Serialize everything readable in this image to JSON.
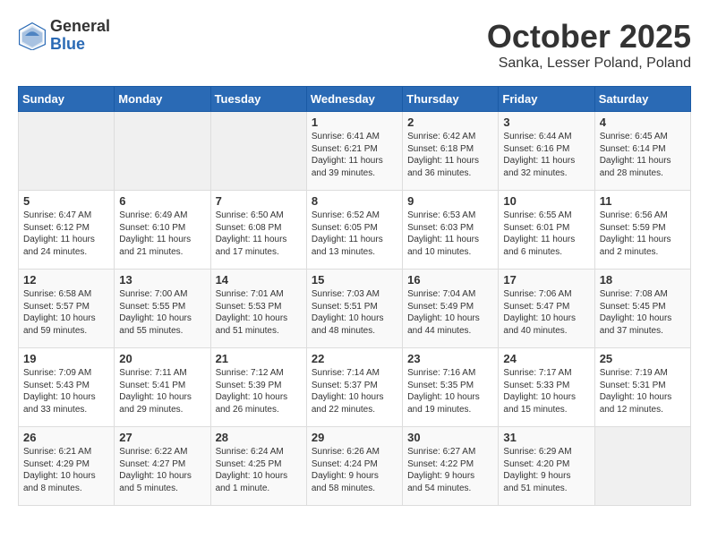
{
  "header": {
    "logo_general": "General",
    "logo_blue": "Blue",
    "month_title": "October 2025",
    "location": "Sanka, Lesser Poland, Poland"
  },
  "weekdays": [
    "Sunday",
    "Monday",
    "Tuesday",
    "Wednesday",
    "Thursday",
    "Friday",
    "Saturday"
  ],
  "weeks": [
    [
      {
        "day": "",
        "info": ""
      },
      {
        "day": "",
        "info": ""
      },
      {
        "day": "",
        "info": ""
      },
      {
        "day": "1",
        "info": "Sunrise: 6:41 AM\nSunset: 6:21 PM\nDaylight: 11 hours\nand 39 minutes."
      },
      {
        "day": "2",
        "info": "Sunrise: 6:42 AM\nSunset: 6:18 PM\nDaylight: 11 hours\nand 36 minutes."
      },
      {
        "day": "3",
        "info": "Sunrise: 6:44 AM\nSunset: 6:16 PM\nDaylight: 11 hours\nand 32 minutes."
      },
      {
        "day": "4",
        "info": "Sunrise: 6:45 AM\nSunset: 6:14 PM\nDaylight: 11 hours\nand 28 minutes."
      }
    ],
    [
      {
        "day": "5",
        "info": "Sunrise: 6:47 AM\nSunset: 6:12 PM\nDaylight: 11 hours\nand 24 minutes."
      },
      {
        "day": "6",
        "info": "Sunrise: 6:49 AM\nSunset: 6:10 PM\nDaylight: 11 hours\nand 21 minutes."
      },
      {
        "day": "7",
        "info": "Sunrise: 6:50 AM\nSunset: 6:08 PM\nDaylight: 11 hours\nand 17 minutes."
      },
      {
        "day": "8",
        "info": "Sunrise: 6:52 AM\nSunset: 6:05 PM\nDaylight: 11 hours\nand 13 minutes."
      },
      {
        "day": "9",
        "info": "Sunrise: 6:53 AM\nSunset: 6:03 PM\nDaylight: 11 hours\nand 10 minutes."
      },
      {
        "day": "10",
        "info": "Sunrise: 6:55 AM\nSunset: 6:01 PM\nDaylight: 11 hours\nand 6 minutes."
      },
      {
        "day": "11",
        "info": "Sunrise: 6:56 AM\nSunset: 5:59 PM\nDaylight: 11 hours\nand 2 minutes."
      }
    ],
    [
      {
        "day": "12",
        "info": "Sunrise: 6:58 AM\nSunset: 5:57 PM\nDaylight: 10 hours\nand 59 minutes."
      },
      {
        "day": "13",
        "info": "Sunrise: 7:00 AM\nSunset: 5:55 PM\nDaylight: 10 hours\nand 55 minutes."
      },
      {
        "day": "14",
        "info": "Sunrise: 7:01 AM\nSunset: 5:53 PM\nDaylight: 10 hours\nand 51 minutes."
      },
      {
        "day": "15",
        "info": "Sunrise: 7:03 AM\nSunset: 5:51 PM\nDaylight: 10 hours\nand 48 minutes."
      },
      {
        "day": "16",
        "info": "Sunrise: 7:04 AM\nSunset: 5:49 PM\nDaylight: 10 hours\nand 44 minutes."
      },
      {
        "day": "17",
        "info": "Sunrise: 7:06 AM\nSunset: 5:47 PM\nDaylight: 10 hours\nand 40 minutes."
      },
      {
        "day": "18",
        "info": "Sunrise: 7:08 AM\nSunset: 5:45 PM\nDaylight: 10 hours\nand 37 minutes."
      }
    ],
    [
      {
        "day": "19",
        "info": "Sunrise: 7:09 AM\nSunset: 5:43 PM\nDaylight: 10 hours\nand 33 minutes."
      },
      {
        "day": "20",
        "info": "Sunrise: 7:11 AM\nSunset: 5:41 PM\nDaylight: 10 hours\nand 29 minutes."
      },
      {
        "day": "21",
        "info": "Sunrise: 7:12 AM\nSunset: 5:39 PM\nDaylight: 10 hours\nand 26 minutes."
      },
      {
        "day": "22",
        "info": "Sunrise: 7:14 AM\nSunset: 5:37 PM\nDaylight: 10 hours\nand 22 minutes."
      },
      {
        "day": "23",
        "info": "Sunrise: 7:16 AM\nSunset: 5:35 PM\nDaylight: 10 hours\nand 19 minutes."
      },
      {
        "day": "24",
        "info": "Sunrise: 7:17 AM\nSunset: 5:33 PM\nDaylight: 10 hours\nand 15 minutes."
      },
      {
        "day": "25",
        "info": "Sunrise: 7:19 AM\nSunset: 5:31 PM\nDaylight: 10 hours\nand 12 minutes."
      }
    ],
    [
      {
        "day": "26",
        "info": "Sunrise: 6:21 AM\nSunset: 4:29 PM\nDaylight: 10 hours\nand 8 minutes."
      },
      {
        "day": "27",
        "info": "Sunrise: 6:22 AM\nSunset: 4:27 PM\nDaylight: 10 hours\nand 5 minutes."
      },
      {
        "day": "28",
        "info": "Sunrise: 6:24 AM\nSunset: 4:25 PM\nDaylight: 10 hours\nand 1 minute."
      },
      {
        "day": "29",
        "info": "Sunrise: 6:26 AM\nSunset: 4:24 PM\nDaylight: 9 hours\nand 58 minutes."
      },
      {
        "day": "30",
        "info": "Sunrise: 6:27 AM\nSunset: 4:22 PM\nDaylight: 9 hours\nand 54 minutes."
      },
      {
        "day": "31",
        "info": "Sunrise: 6:29 AM\nSunset: 4:20 PM\nDaylight: 9 hours\nand 51 minutes."
      },
      {
        "day": "",
        "info": ""
      }
    ]
  ]
}
